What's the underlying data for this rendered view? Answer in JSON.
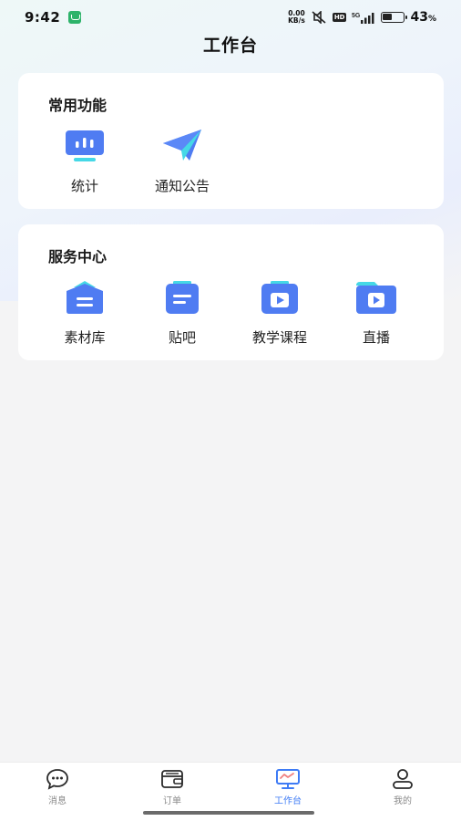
{
  "status_bar": {
    "time": "9:42",
    "net_speed_value": "0.00",
    "net_speed_unit": "KB/s",
    "hd": "HD",
    "network": "5G",
    "battery_level": 0.43,
    "battery_percent": "43",
    "battery_unit": "%"
  },
  "header": {
    "title": "工作台"
  },
  "common": {
    "title": "常用功能",
    "items": [
      {
        "label": "统计",
        "icon": "monitor-chart-icon"
      },
      {
        "label": "通知公告",
        "icon": "paper-plane-icon"
      }
    ]
  },
  "service": {
    "title": "服务中心",
    "items": [
      {
        "label": "素材库",
        "icon": "material-library-icon"
      },
      {
        "label": "贴吧",
        "icon": "forum-note-icon"
      },
      {
        "label": "教学课程",
        "icon": "video-course-icon"
      },
      {
        "label": "直播",
        "icon": "live-folder-icon"
      }
    ]
  },
  "bottom_nav": {
    "items": [
      {
        "label": "消息",
        "icon": "chat-bubble-icon",
        "active": false
      },
      {
        "label": "订单",
        "icon": "wallet-icon",
        "active": false
      },
      {
        "label": "工作台",
        "icon": "workbench-monitor-icon",
        "active": true
      },
      {
        "label": "我的",
        "icon": "profile-icon",
        "active": false
      }
    ]
  },
  "colors": {
    "accent": "#3e7bf5",
    "icon_blue": "#4f7cf2",
    "icon_cyan": "#45d8e6",
    "nav_inactive": "#8a8a8a"
  }
}
